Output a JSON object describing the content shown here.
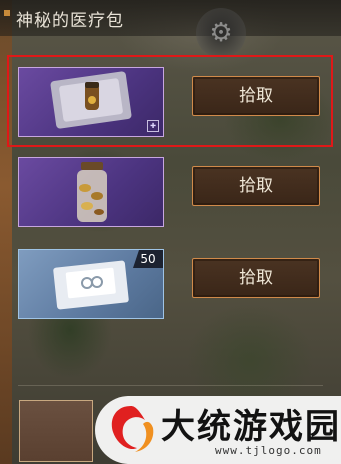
{
  "header": {
    "title": "神秘的医疗包"
  },
  "items": [
    {
      "name": "medkit-package",
      "rarity": "purple",
      "pickup_label": "拾取",
      "quantity": ""
    },
    {
      "name": "pill-jar",
      "rarity": "purple",
      "pickup_label": "拾取",
      "quantity": ""
    },
    {
      "name": "bandage-pack",
      "rarity": "blue",
      "pickup_label": "拾取",
      "quantity": "50"
    }
  ],
  "watermark": {
    "title": "大统游戏园",
    "url": "www.tjlogo.com"
  },
  "colors": {
    "highlight": "#e01818",
    "purple_rarity": "#6a4aa0",
    "blue_rarity": "#7f9cbf",
    "button_border": "#d08a4a"
  }
}
